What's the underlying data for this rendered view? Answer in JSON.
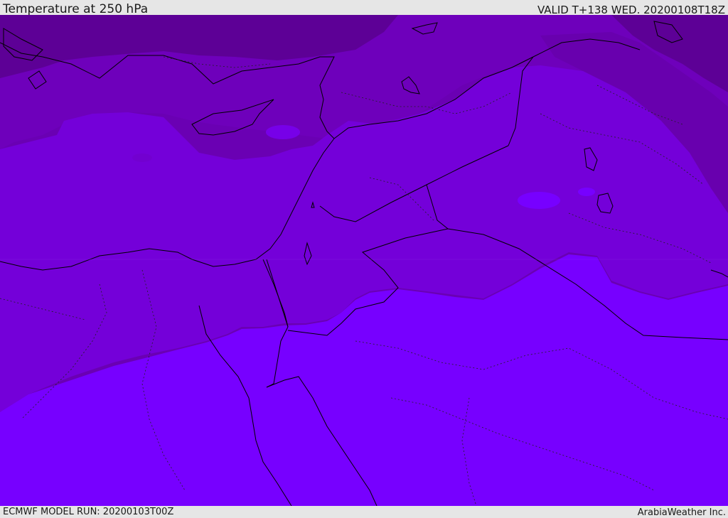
{
  "header": {
    "title": "Temperature at 250 hPa",
    "valid": "VALID T+138 WED. 20200108T18Z"
  },
  "footer": {
    "model_run": "ECMWF MODEL RUN: 20200103T00Z",
    "credit": "ArabiaWeather Inc."
  },
  "colors": {
    "coldest": "#5c0096",
    "cold": "#6700ac",
    "mid": "#7500c6",
    "warmer": "#7a00e3",
    "warmest": "#7700ff",
    "boundary": "#000000"
  }
}
